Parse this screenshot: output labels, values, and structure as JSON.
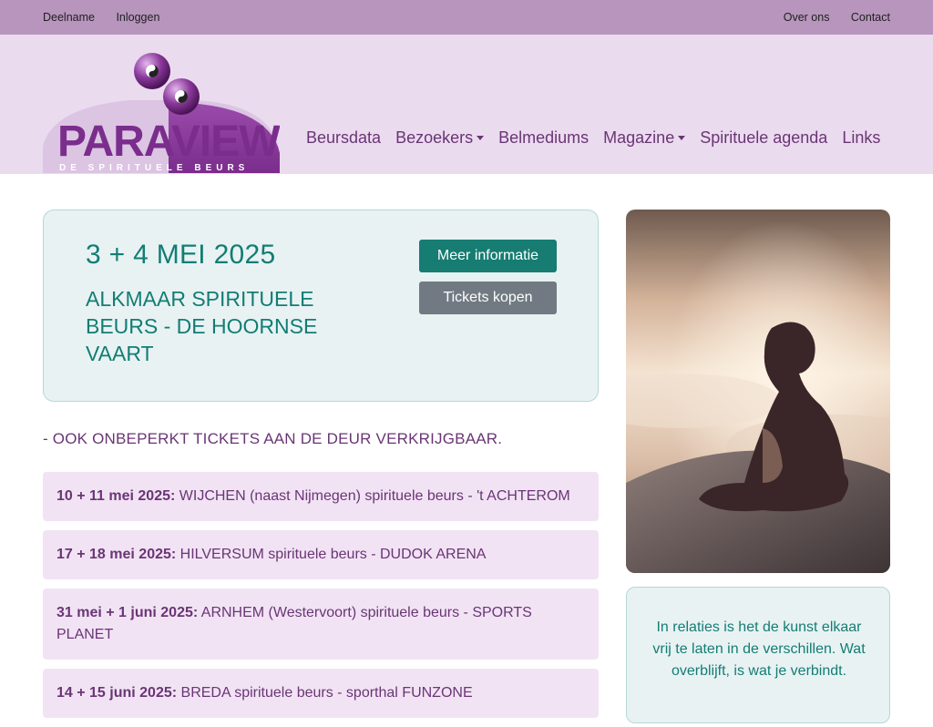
{
  "topbar": {
    "left": [
      "Deelname",
      "Inloggen"
    ],
    "right": [
      "Over ons",
      "Contact"
    ]
  },
  "logo": {
    "name": "PARAVIEW",
    "tagline": "DE SPIRITUELE BEURS"
  },
  "nav": {
    "items": [
      {
        "label": "Beursdata"
      },
      {
        "label": "Bezoekers"
      },
      {
        "label": "Belmediums"
      },
      {
        "label": "Magazine"
      },
      {
        "label": "Spirituele agenda"
      },
      {
        "label": "Links"
      }
    ]
  },
  "hero": {
    "date": "3 + 4 MEI 2025",
    "title": "ALKMAAR SPIRITUELE BEURS - DE HOORNSE VAART",
    "info_button": "Meer informatie",
    "tickets_button": "Tickets kopen"
  },
  "notice": "- OOK ONBEPERKT TICKETS AAN DE DEUR VERKRIJGBAAR.",
  "events": [
    {
      "date": "10 + 11 mei 2025:",
      "text": " WIJCHEN (naast Nijmegen) spirituele beurs - 't ACHTEROM"
    },
    {
      "date": "17 + 18 mei 2025:",
      "text": " HILVERSUM spirituele beurs - DUDOK ARENA"
    },
    {
      "date": "31 mei + 1 juni 2025:",
      "text": " ARNHEM (Westervoort) spirituele beurs - SPORTS PLANET"
    },
    {
      "date": "14 + 15 juni 2025:",
      "text": " BREDA spirituele beurs - sporthal FUNZONE"
    }
  ],
  "quote": "In relaties is het de kunst elkaar vrij te laten in de verschillen. Wat overblijft, is wat je verbindt.",
  "colors": {
    "topbar": "#b795bd",
    "header": "#ebdbef",
    "accent_teal": "#137d74",
    "accent_purple": "#6a3575"
  }
}
